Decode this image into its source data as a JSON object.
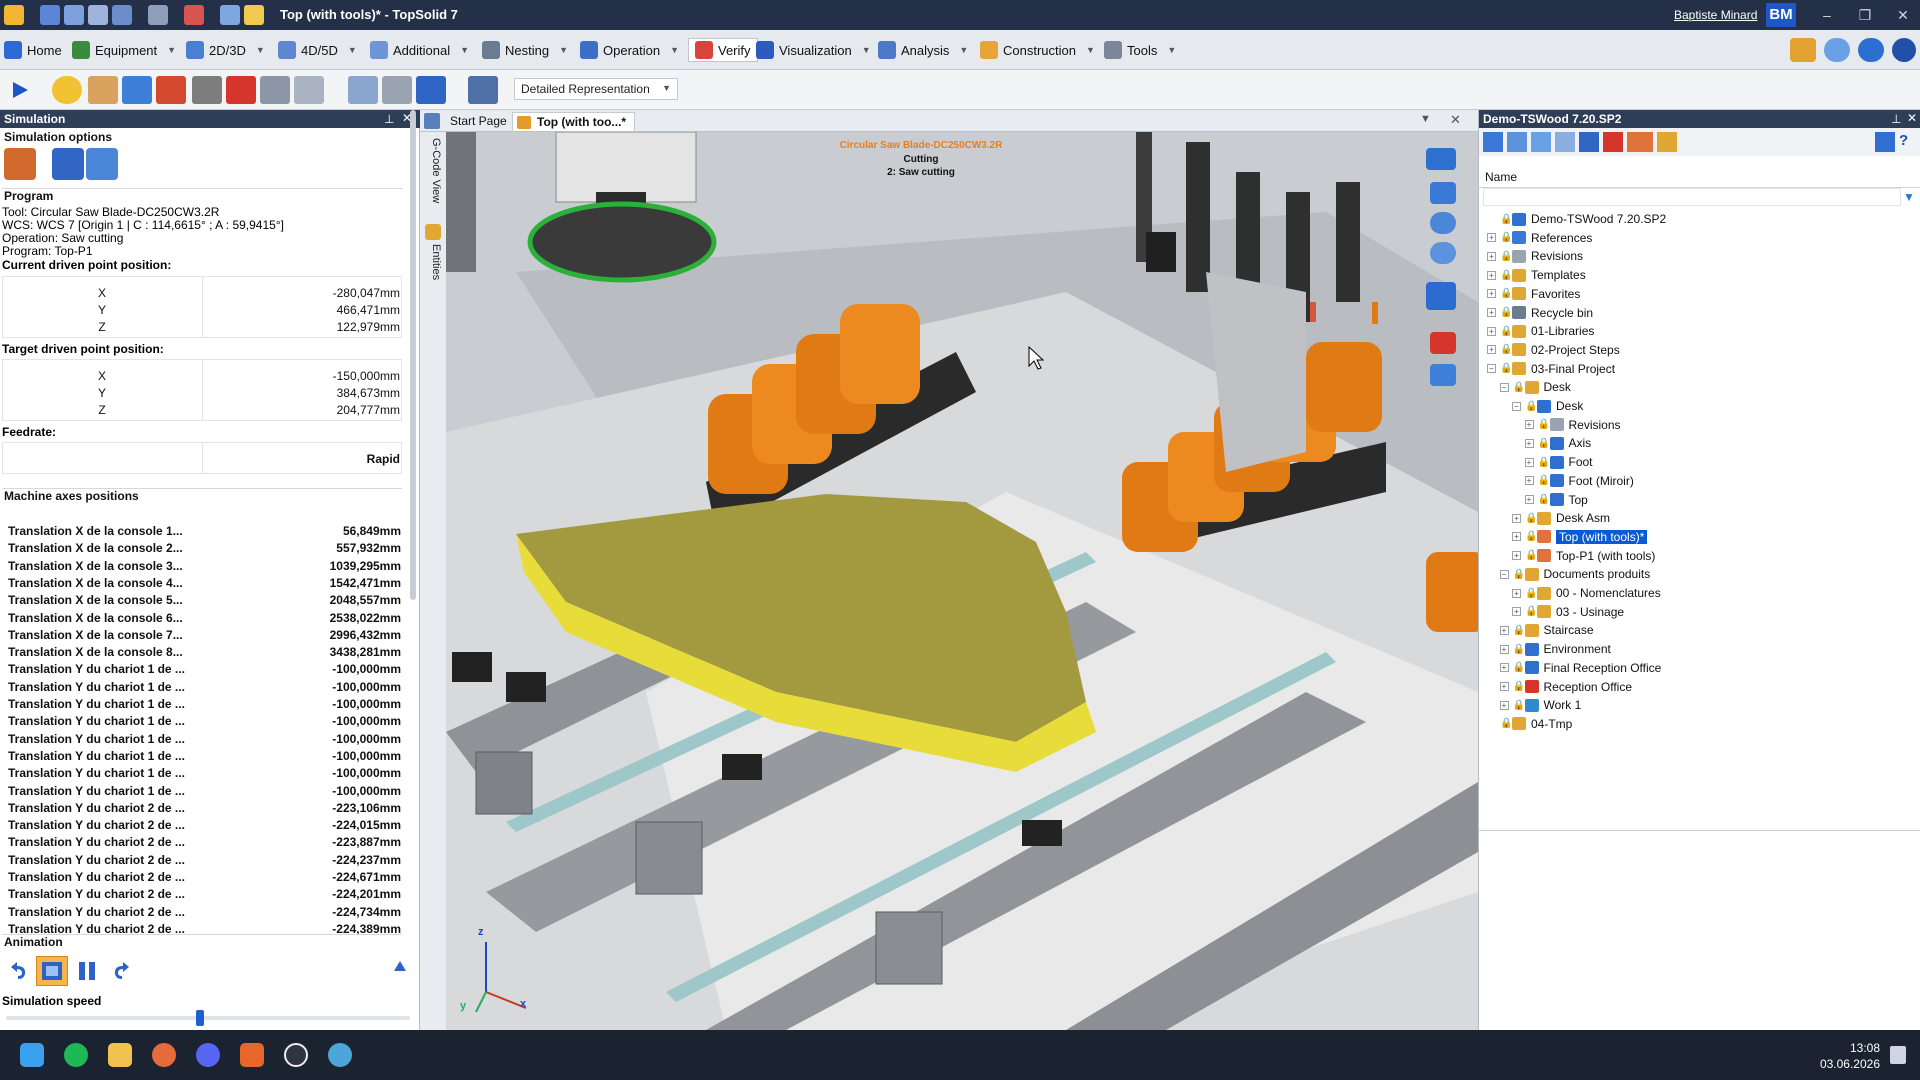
{
  "window": {
    "title": "Top (with tools)* - TopSolid 7",
    "user": "Baptiste Minard",
    "user_initials": "BM",
    "controls": {
      "minimize": "–",
      "restore": "❐",
      "close": "✕"
    }
  },
  "menu": {
    "items": [
      {
        "label": "Home"
      },
      {
        "label": "Equipment"
      },
      {
        "label": "2D/3D"
      },
      {
        "label": "4D/5D"
      },
      {
        "label": "Additional"
      },
      {
        "label": "Nesting"
      },
      {
        "label": "Operation"
      },
      {
        "label": "Verify"
      },
      {
        "label": "Visualization"
      },
      {
        "label": "Analysis"
      },
      {
        "label": "Construction"
      },
      {
        "label": "Tools"
      }
    ],
    "dropdown_glyph": "▼"
  },
  "toolbar": {
    "representation": "Detailed Representation"
  },
  "simulation": {
    "panel_title": "Simulation",
    "options_title": "Simulation options",
    "program_title": "Program",
    "program_lines": [
      "Tool: Circular Saw Blade-DC250CW3.2R",
      "WCS: WCS 7 [Origin 1 | C : 114,6615° ; A : 59,9415°]",
      "Operation: Saw cutting",
      "Program: Top-P1",
      "Current driven point position:"
    ],
    "current": [
      {
        "axis": "X",
        "value": "-280,047mm"
      },
      {
        "axis": "Y",
        "value": "466,471mm"
      },
      {
        "axis": "Z",
        "value": "122,979mm"
      }
    ],
    "target_label": "Target driven point position:",
    "target": [
      {
        "axis": "X",
        "value": "-150,000mm"
      },
      {
        "axis": "Y",
        "value": "384,673mm"
      },
      {
        "axis": "Z",
        "value": "204,777mm"
      }
    ],
    "feedrate_label": "Feedrate:",
    "feedrate_value": "Rapid",
    "axes_title": "Machine axes positions",
    "axes": [
      {
        "name": "Translation X de la console 1...",
        "value": "56,849mm"
      },
      {
        "name": "Translation X de la console 2...",
        "value": "557,932mm"
      },
      {
        "name": "Translation X de la console 3...",
        "value": "1039,295mm"
      },
      {
        "name": "Translation X de la console 4...",
        "value": "1542,471mm"
      },
      {
        "name": "Translation X de la console 5...",
        "value": "2048,557mm"
      },
      {
        "name": "Translation X de la console 6...",
        "value": "2538,022mm"
      },
      {
        "name": "Translation X de la console 7...",
        "value": "2996,432mm"
      },
      {
        "name": "Translation X de la console 8...",
        "value": "3438,281mm"
      },
      {
        "name": "Translation Y du chariot 1 de ...",
        "value": "-100,000mm"
      },
      {
        "name": "Translation Y du chariot 1 de ...",
        "value": "-100,000mm"
      },
      {
        "name": "Translation Y du chariot 1 de ...",
        "value": "-100,000mm"
      },
      {
        "name": "Translation Y du chariot 1 de ...",
        "value": "-100,000mm"
      },
      {
        "name": "Translation Y du chariot 1 de ...",
        "value": "-100,000mm"
      },
      {
        "name": "Translation Y du chariot 1 de ...",
        "value": "-100,000mm"
      },
      {
        "name": "Translation Y du chariot 1 de ...",
        "value": "-100,000mm"
      },
      {
        "name": "Translation Y du chariot 1 de ...",
        "value": "-100,000mm"
      },
      {
        "name": "Translation Y du chariot 2 de ...",
        "value": "-223,106mm"
      },
      {
        "name": "Translation Y du chariot 2 de ...",
        "value": "-224,015mm"
      },
      {
        "name": "Translation Y du chariot 2 de ...",
        "value": "-223,887mm"
      },
      {
        "name": "Translation Y du chariot 2 de ...",
        "value": "-224,237mm"
      },
      {
        "name": "Translation Y du chariot 2 de ...",
        "value": "-224,671mm"
      },
      {
        "name": "Translation Y du chariot 2 de ...",
        "value": "-224,201mm"
      },
      {
        "name": "Translation Y du chariot 2 de ...",
        "value": "-224,734mm"
      },
      {
        "name": "Translation Y du chariot 2 de ...",
        "value": "-224,389mm"
      }
    ],
    "animation_title": "Animation",
    "speed_label": "Simulation speed",
    "speed_level": 0.48
  },
  "document_tabs": [
    {
      "label": "Start Page"
    },
    {
      "label": "Top (with too...*"
    }
  ],
  "side_tabs": [
    "G-Code View",
    "Entities"
  ],
  "viewport": {
    "annotation_tool": "Circular Saw Blade-DC250CW3.2R",
    "annotation_state": "Cutting",
    "annotation_op": "2: Saw cutting",
    "axis_labels": {
      "x": "x",
      "y": "y",
      "z": "z"
    }
  },
  "project_panel": {
    "title": "Demo-TSWood 7.20.SP2",
    "column_name": "Name",
    "tree": [
      {
        "label": "Demo-TSWood 7.20.SP2",
        "level": 0,
        "exp": "",
        "icon": "project-icon"
      },
      {
        "label": "References",
        "level": 0,
        "exp": "+",
        "icon": "references-icon"
      },
      {
        "label": "Revisions",
        "level": 0,
        "exp": "+",
        "icon": "revisions-icon"
      },
      {
        "label": "Templates",
        "level": 0,
        "exp": "+",
        "icon": "folder-icon"
      },
      {
        "label": "Favorites",
        "level": 0,
        "exp": "+",
        "icon": "folder-icon"
      },
      {
        "label": "Recycle bin",
        "level": 0,
        "exp": "+",
        "icon": "recycle-bin-icon"
      },
      {
        "label": "01-Libraries",
        "level": 0,
        "exp": "+",
        "icon": "folder-icon"
      },
      {
        "label": "02-Project Steps",
        "level": 0,
        "exp": "+",
        "icon": "folder-icon"
      },
      {
        "label": "03-Final Project",
        "level": 0,
        "exp": "−",
        "icon": "folder-icon"
      },
      {
        "label": "Desk",
        "level": 1,
        "exp": "−",
        "icon": "folder-icon"
      },
      {
        "label": "Desk",
        "level": 2,
        "exp": "−",
        "icon": "part-icon"
      },
      {
        "label": "Revisions",
        "level": 3,
        "exp": "+",
        "icon": "revisions-icon"
      },
      {
        "label": "Axis",
        "level": 3,
        "exp": "+",
        "icon": "part-icon"
      },
      {
        "label": "Foot",
        "level": 3,
        "exp": "+",
        "icon": "part-icon"
      },
      {
        "label": "Foot (Miroir)",
        "level": 3,
        "exp": "+",
        "icon": "part-icon"
      },
      {
        "label": "Top",
        "level": 3,
        "exp": "+",
        "icon": "part-icon"
      },
      {
        "label": "Desk Asm",
        "level": 2,
        "exp": "+",
        "icon": "assembly-icon"
      },
      {
        "label": "Top (with tools)*",
        "level": 2,
        "exp": "+",
        "icon": "cam-icon",
        "selected": true
      },
      {
        "label": "Top-P1 (with tools)",
        "level": 2,
        "exp": "+",
        "icon": "cam-icon"
      },
      {
        "label": "Documents produits",
        "level": 1,
        "exp": "−",
        "icon": "folder-icon"
      },
      {
        "label": "00 - Nomenclatures",
        "level": 2,
        "exp": "+",
        "icon": "folder-icon"
      },
      {
        "label": "03 - Usinage",
        "level": 2,
        "exp": "+",
        "icon": "folder-icon"
      },
      {
        "label": "Staircase",
        "level": 1,
        "exp": "+",
        "icon": "folder-icon"
      },
      {
        "label": "Environment",
        "level": 1,
        "exp": "+",
        "icon": "part-icon"
      },
      {
        "label": "Final Reception Office",
        "level": 1,
        "exp": "+",
        "icon": "part-icon"
      },
      {
        "label": "Reception Office",
        "level": 1,
        "exp": "+",
        "icon": "check-icon"
      },
      {
        "label": "Work 1",
        "level": 1,
        "exp": "+",
        "icon": "gear-icon"
      },
      {
        "label": "04-Tmp",
        "level": 0,
        "exp": "",
        "icon": "folder-icon"
      }
    ]
  },
  "taskbar": {
    "time": "13:08",
    "date": "03.06.2026"
  },
  "colors": {
    "accent": "#0a59d6",
    "workpiece": "#a39a3f",
    "workpiece_edge": "#e8dc3a",
    "suction_cup": "#e07a14"
  }
}
